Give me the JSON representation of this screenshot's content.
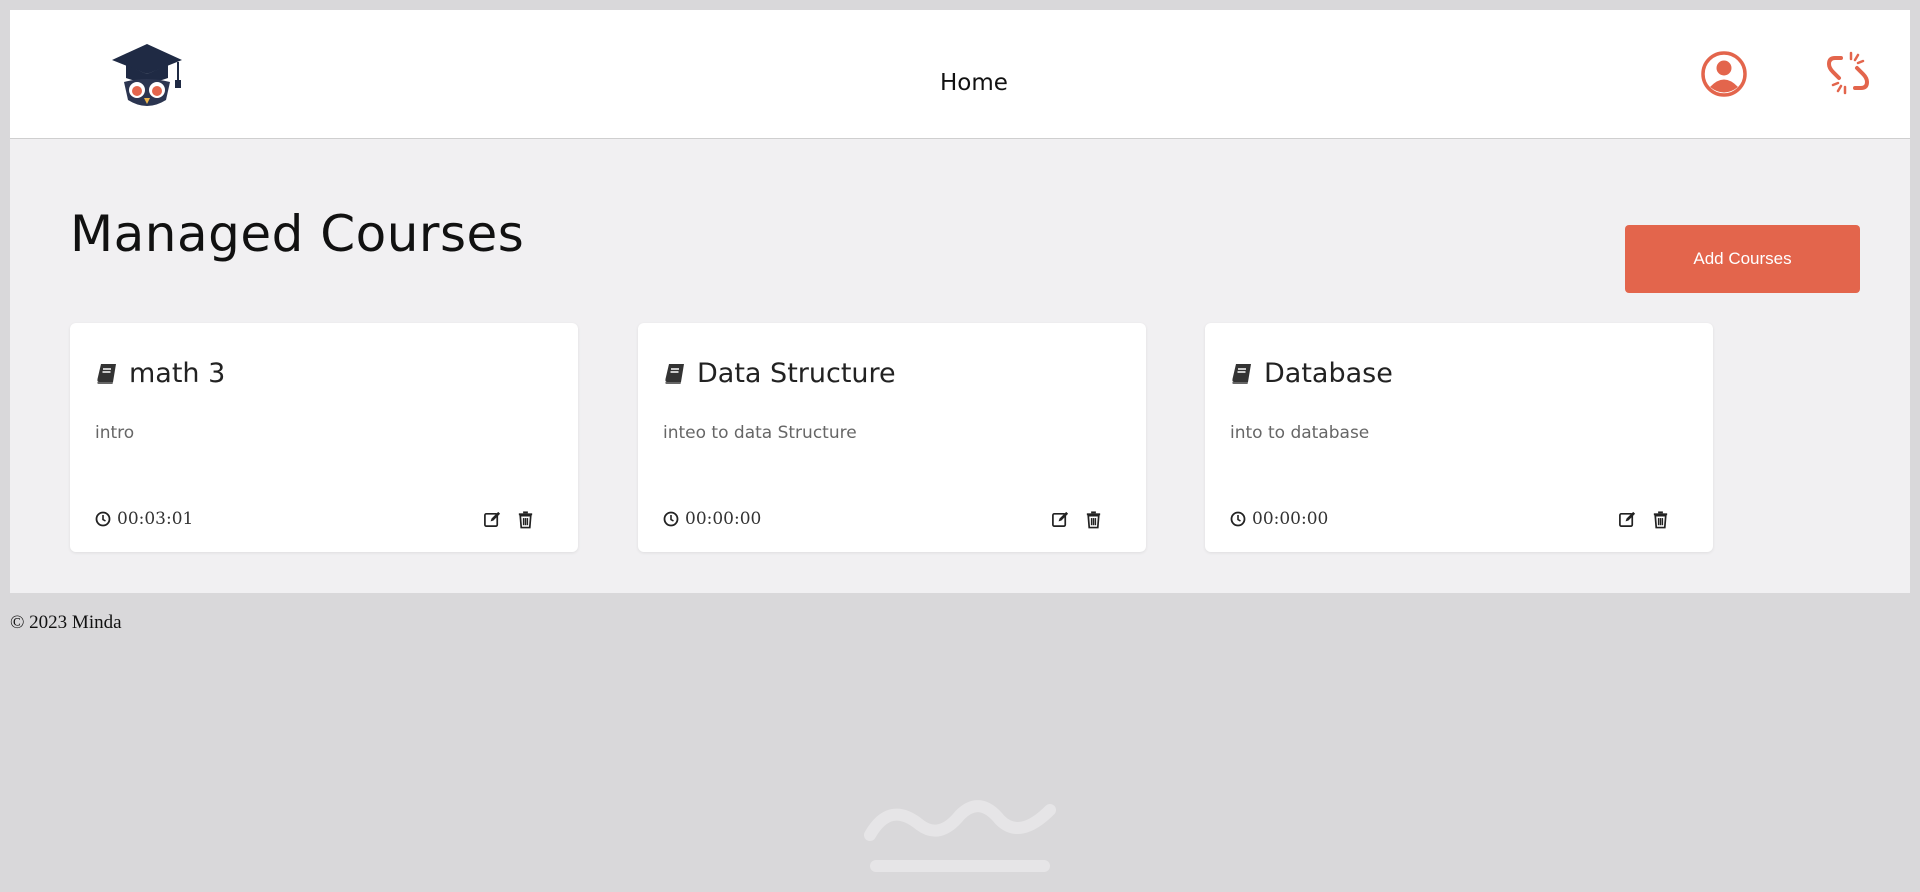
{
  "nav": {
    "home_label": "Home"
  },
  "icons": {
    "logo": "graduation-cap-owl-logo",
    "profile": "user-circle-icon",
    "logout": "broken-link-icon"
  },
  "colors": {
    "accent": "#e3654c",
    "page_bg": "#f1f0f2",
    "outer_bg": "#d9d8da"
  },
  "page": {
    "title": "Managed Courses",
    "add_button_label": "Add Courses"
  },
  "courses": [
    {
      "name": "math 3",
      "description": "intro",
      "duration": "00:03:01"
    },
    {
      "name": "Data Structure",
      "description": "inteo to data Structure",
      "duration": "00:00:00"
    },
    {
      "name": "Database",
      "description": "into to database",
      "duration": "00:00:00"
    }
  ],
  "footer": {
    "text": "© 2023 Minda"
  }
}
